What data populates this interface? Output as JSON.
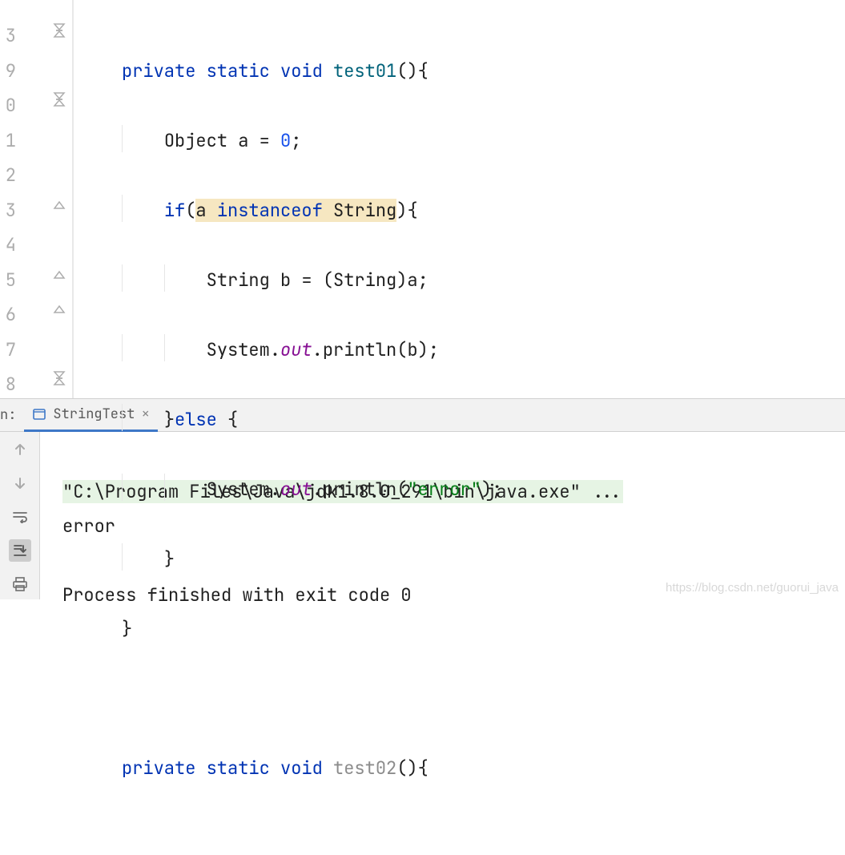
{
  "lineNumbers": [
    "3",
    "9",
    "0",
    "1",
    "2",
    "3",
    "4",
    "5",
    "6",
    "7",
    "8"
  ],
  "code": {
    "l1": {
      "kw1": "private",
      "kw2": "static",
      "kw3": "void",
      "fn": "test01",
      "tail": "(){"
    },
    "l2": {
      "type": "Object",
      "text": " a = ",
      "num": "0",
      "semi": ";"
    },
    "l3": {
      "kw": "if",
      "open": "(",
      "hl_a": "a ",
      "hl_kw": "instanceof",
      "hl_sp": " ",
      "hl_type": "String",
      "close": "){"
    },
    "l4": {
      "text": "String b = (String)a;"
    },
    "l5": {
      "sys": "System.",
      "field": "out",
      "dot": ".",
      "call": "println(b);"
    },
    "l6": {
      "close": "}",
      "kw": "else",
      "open": " {"
    },
    "l7": {
      "sys": "System.",
      "field": "out",
      "dot": ".",
      "pr": "println(",
      "str": "\"error\"",
      "tail": ");"
    },
    "l8": {
      "text": "}"
    },
    "l9": {
      "text": "}"
    },
    "l10": {
      "text": ""
    },
    "l11": {
      "kw1": "private",
      "kw2": "static",
      "kw3": "void",
      "fn": "test02",
      "tail": "(){"
    }
  },
  "run": {
    "label": "n:",
    "tabName": "StringTest",
    "cmd": "\"C:\\Program Files\\Java\\jdk1.8.0_291\\bin\\java.exe\" ...",
    "out": "error",
    "blank": "",
    "exit": "Process finished with exit code 0"
  },
  "watermark": "https://blog.csdn.net/guorui_java"
}
